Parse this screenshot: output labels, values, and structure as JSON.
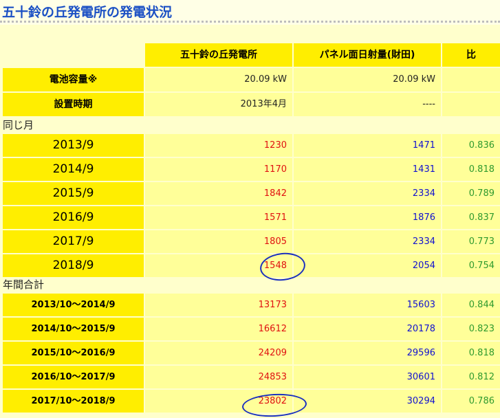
{
  "page": {
    "title": "五十鈴の丘発電所の発電状況"
  },
  "table": {
    "headers": [
      "五十鈴の丘発電所",
      "パネル面日射量(財田)",
      "比"
    ],
    "specs": [
      {
        "label": "電池容量※",
        "plant": "20.09 kW",
        "panel": "20.09 kW",
        "ratio": ""
      },
      {
        "label": "設置時期",
        "plant": "2013年4月",
        "panel": "----",
        "ratio": ""
      }
    ],
    "same_month_heading": "同じ月",
    "same_month": [
      {
        "label": "2013/9",
        "plant": "1230",
        "panel": "1471",
        "ratio": "0.836"
      },
      {
        "label": "2014/9",
        "plant": "1170",
        "panel": "1431",
        "ratio": "0.818"
      },
      {
        "label": "2015/9",
        "plant": "1842",
        "panel": "2334",
        "ratio": "0.789"
      },
      {
        "label": "2016/9",
        "plant": "1571",
        "panel": "1876",
        "ratio": "0.837"
      },
      {
        "label": "2017/9",
        "plant": "1805",
        "panel": "2334",
        "ratio": "0.773"
      },
      {
        "label": "2018/9",
        "plant": "1548",
        "panel": "2054",
        "ratio": "0.754"
      }
    ],
    "annual_heading": "年間合計",
    "annual": [
      {
        "label": "2013/10〜2014/9",
        "plant": "13173",
        "panel": "15603",
        "ratio": "0.844"
      },
      {
        "label": "2014/10〜2015/9",
        "plant": "16612",
        "panel": "20178",
        "ratio": "0.823"
      },
      {
        "label": "2015/10〜2016/9",
        "plant": "24209",
        "panel": "29596",
        "ratio": "0.818"
      },
      {
        "label": "2016/10〜2017/9",
        "plant": "24853",
        "panel": "30601",
        "ratio": "0.812"
      },
      {
        "label": "2017/10〜2018/9",
        "plant": "23802",
        "panel": "30294",
        "ratio": "0.786"
      }
    ]
  },
  "colors": {
    "label_bg": "#ffee00",
    "value_bg": "#ffff99",
    "page_bg": "#ffffcc",
    "plant_text": "#e01010",
    "panel_text": "#1010d0",
    "ratio_text": "#2e9a2e",
    "annotation": "#1a2fbf"
  }
}
